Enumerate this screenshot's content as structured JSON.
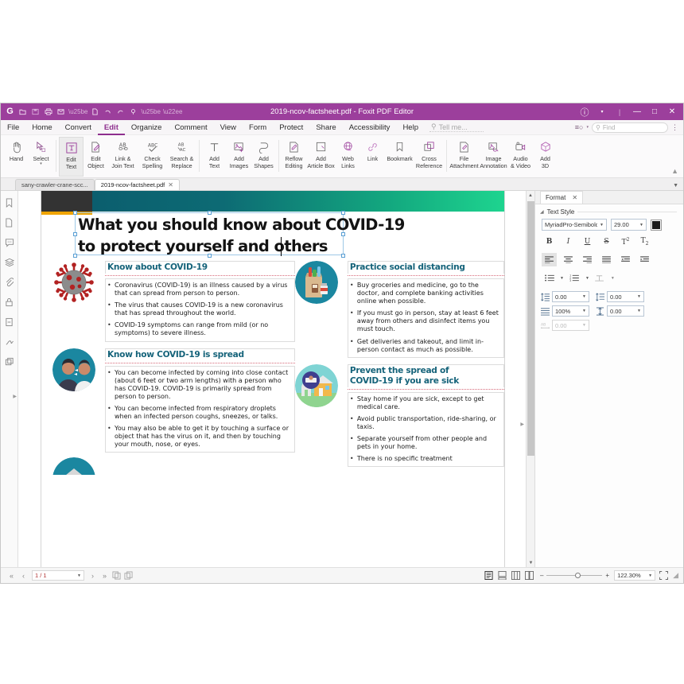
{
  "window": {
    "title": "2019-ncov-factsheet.pdf - Foxit PDF Editor",
    "quick_access": [
      {
        "name": "foxit-logo-icon",
        "glyph": "G"
      },
      {
        "name": "open-file-icon",
        "glyph": "◱"
      },
      {
        "name": "save-icon",
        "glyph": "▤"
      },
      {
        "name": "print-icon",
        "glyph": "⎙"
      },
      {
        "name": "email-icon",
        "glyph": "✉"
      },
      {
        "name": "create-pdf-icon",
        "glyph": "Ὄ4"
      },
      {
        "name": "undo-icon",
        "glyph": "↶"
      },
      {
        "name": "redo-icon",
        "glyph": "↷"
      },
      {
        "name": "highlight-icon",
        "glyph": "✎"
      }
    ],
    "controls": {
      "account": "ⓐ",
      "minimize": "—",
      "maximize": "□",
      "close": "✕"
    }
  },
  "menu": {
    "items": [
      {
        "label": "File",
        "active": false
      },
      {
        "label": "Home",
        "active": false
      },
      {
        "label": "Convert",
        "active": false
      },
      {
        "label": "Edit",
        "active": true
      },
      {
        "label": "Organize",
        "active": false
      },
      {
        "label": "Comment",
        "active": false
      },
      {
        "label": "View",
        "active": false
      },
      {
        "label": "Form",
        "active": false
      },
      {
        "label": "Protect",
        "active": false
      },
      {
        "label": "Share",
        "active": false
      },
      {
        "label": "Accessibility",
        "active": false
      },
      {
        "label": "Help",
        "active": false
      }
    ],
    "tell_me": "Tell me...",
    "find_placeholder": "Find"
  },
  "ribbon": {
    "groups": [
      {
        "items": [
          {
            "label": "Hand",
            "icon": "hand-icon",
            "selected": false,
            "dropdown": false
          },
          {
            "label": "Select",
            "icon": "select-icon",
            "selected": false,
            "dropdown": true
          }
        ]
      },
      {
        "items": [
          {
            "label": "Edit\nText",
            "line1": "Edit",
            "line2": "Text",
            "icon": "edit-text-icon",
            "selected": true,
            "dropdown": false
          },
          {
            "label": "Edit\nObject",
            "line1": "Edit",
            "line2": "Object",
            "icon": "edit-object-icon",
            "selected": false,
            "dropdown": true
          },
          {
            "label": "Link &\nJoin Text",
            "line1": "Link &",
            "line2": "Join Text",
            "icon": "link-join-text-icon",
            "selected": false,
            "dropdown": false
          },
          {
            "label": "Check\nSpelling",
            "line1": "Check",
            "line2": "Spelling",
            "icon": "check-spelling-icon",
            "selected": false,
            "dropdown": false
          },
          {
            "label": "Search &\nReplace",
            "line1": "Search &",
            "line2": "Replace",
            "icon": "search-replace-icon",
            "selected": false,
            "dropdown": false
          }
        ]
      },
      {
        "items": [
          {
            "line1": "Add",
            "line2": "Text",
            "icon": "add-text-icon",
            "selected": false,
            "dropdown": false
          },
          {
            "line1": "Add",
            "line2": "Images",
            "icon": "add-images-icon",
            "selected": false,
            "dropdown": true
          },
          {
            "line1": "Add",
            "line2": "Shapes",
            "icon": "add-shapes-icon",
            "selected": false,
            "dropdown": true
          },
          {
            "line1": "Reflow",
            "line2": "Editing",
            "icon": "reflow-editing-icon",
            "selected": false,
            "dropdown": false
          },
          {
            "line1": "Add",
            "line2": "Article Box",
            "icon": "add-article-box-icon",
            "selected": false,
            "dropdown": false
          },
          {
            "line1": "Web",
            "line2": "Links",
            "icon": "web-links-icon",
            "selected": false,
            "dropdown": true
          },
          {
            "line1": "Link",
            "line2": "",
            "icon": "link-icon",
            "selected": false,
            "dropdown": false
          },
          {
            "line1": "Bookmark",
            "line2": "",
            "icon": "bookmark-icon",
            "selected": false,
            "dropdown": false
          },
          {
            "line1": "Cross",
            "line2": "Reference",
            "icon": "cross-reference-icon",
            "selected": false,
            "dropdown": false
          }
        ]
      },
      {
        "items": [
          {
            "line1": "File",
            "line2": "Attachment",
            "icon": "file-attachment-icon",
            "selected": false,
            "dropdown": false
          },
          {
            "line1": "Image",
            "line2": "Annotation",
            "icon": "image-annotation-icon",
            "selected": false,
            "dropdown": false
          },
          {
            "line1": "Audio",
            "line2": "& Video",
            "icon": "audio-video-icon",
            "selected": false,
            "dropdown": false
          },
          {
            "line1": "Add",
            "line2": "3D",
            "icon": "add-3d-icon",
            "selected": false,
            "dropdown": false
          }
        ]
      }
    ]
  },
  "doc_tabs": [
    {
      "label": "sany-crawler-crane-scc...",
      "active": false,
      "closable": false
    },
    {
      "label": "2019-ncov-factsheet.pdf",
      "active": true,
      "closable": true
    }
  ],
  "nav_panel": {
    "icons": [
      {
        "name": "bookmark-icon",
        "glyph": "☑"
      },
      {
        "name": "page-thumbnails-icon",
        "glyph": "❐"
      },
      {
        "name": "comments-icon",
        "glyph": "Ὂc"
      },
      {
        "name": "layers-icon",
        "glyph": "≣"
      },
      {
        "name": "attachments-icon",
        "glyph": "Ὄe"
      },
      {
        "name": "security-icon",
        "glyph": "ὑ2"
      },
      {
        "name": "destinations-icon",
        "glyph": "☷"
      },
      {
        "name": "signatures-icon",
        "glyph": "✍"
      },
      {
        "name": "stamps-icon",
        "glyph": "⧉"
      }
    ]
  },
  "document": {
    "title_line1": "What you should know about COVID-19",
    "title_line2": "to protect yourself and others",
    "sections": [
      {
        "heading": "Know about COVID-19",
        "icon": "coronavirus-icon",
        "bullets": [
          "Coronavirus (COVID-19) is an illness caused by a virus that can spread from person to person.",
          "The virus that causes COVID-19 is a new coronavirus that has spread throughout the world.",
          "COVID-19 symptoms can range from mild (or no symptoms) to severe illness."
        ]
      },
      {
        "heading": "Know how COVID-19 is spread",
        "icon": "people-talking-icon",
        "bullets": [
          "You can become infected by coming into close contact (about 6 feet or two arm lengths) with a person who has COVID-19. COVID-19 is primarily spread from person to person.",
          "You can become infected from respiratory droplets when an infected person coughs, sneezes, or talks.",
          "You may also be able to get it by touching a surface or object that has the virus on it, and then by touching your mouth, nose, or eyes."
        ]
      },
      {
        "heading": "Practice social distancing",
        "icon": "grocery-bag-icon",
        "bullets": [
          "Buy groceries and medicine, go to the doctor, and complete banking activities online when possible.",
          "If you must go in person, stay at least 6 feet away from others and disinfect items you must touch.",
          "Get deliveries and takeout, and limit in-person contact as much as possible."
        ]
      },
      {
        "heading_line1": "Prevent the spread of",
        "heading_line2": "COVID-19 if you are sick",
        "icon": "stay-home-icon",
        "bullets": [
          "Stay home if you are sick, except to get medical care.",
          "Avoid public transportation, ride-sharing, or taxis.",
          "Separate yourself from other people and pets in your home.",
          "There is no specific treatment"
        ]
      }
    ]
  },
  "format_panel": {
    "tab_label": "Format",
    "tab_close": "✕",
    "section_title": "Text Style",
    "font_family": "MyriadPro-SemiboldC",
    "font_size": "29.00",
    "font_color": "#1a1a1a",
    "style_buttons": [
      {
        "name": "bold-button",
        "glyph": "B",
        "active": false
      },
      {
        "name": "italic-button",
        "glyph": "I",
        "active": false
      },
      {
        "name": "underline-button",
        "glyph": "U",
        "active": false
      },
      {
        "name": "strikethrough-button",
        "glyph": "S",
        "active": false
      },
      {
        "name": "superscript-button",
        "glyph": "T",
        "active": false
      },
      {
        "name": "subscript-button",
        "glyph": "T",
        "active": false
      }
    ],
    "align_buttons": [
      {
        "name": "align-left-button",
        "active": true
      },
      {
        "name": "align-center-button",
        "active": false
      },
      {
        "name": "align-right-button",
        "active": false
      },
      {
        "name": "align-justify-button",
        "active": false
      },
      {
        "name": "decrease-indent-button",
        "active": false
      },
      {
        "name": "increase-indent-button",
        "active": false
      }
    ],
    "list_buttons": [
      {
        "name": "bulleted-list-button"
      },
      {
        "name": "numbered-list-button"
      },
      {
        "name": "text-direction-button"
      }
    ],
    "spacing": [
      {
        "name": "line-spacing-field",
        "value": "0.00",
        "disabled": false
      },
      {
        "name": "paragraph-spacing-field",
        "value": "0.00",
        "disabled": false
      },
      {
        "name": "horizontal-scale-field",
        "value": "100%",
        "disabled": false
      },
      {
        "name": "vertical-offset-field",
        "value": "0.00",
        "disabled": false
      },
      {
        "name": "character-spacing-field",
        "value": "0.00",
        "disabled": true
      }
    ]
  },
  "status_bar": {
    "page_current": "1 / 1",
    "nav_first": "«",
    "nav_prev": "‹",
    "nav_next": "›",
    "nav_last": "»",
    "zoom_out": "–",
    "zoom_in": "+",
    "zoom_level": "122.30%",
    "view_modes": [
      {
        "name": "single-page-view-button",
        "active": true
      },
      {
        "name": "continuous-view-button",
        "active": false
      },
      {
        "name": "facing-view-button",
        "active": false
      },
      {
        "name": "facing-continuous-view-button",
        "active": false
      }
    ]
  }
}
